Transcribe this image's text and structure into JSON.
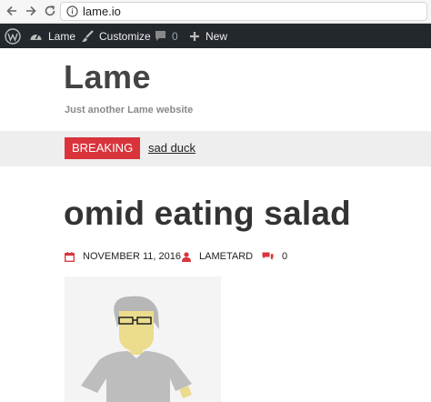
{
  "browser": {
    "url": "lame.io"
  },
  "admin_bar": {
    "site_name": "Lame",
    "customize_label": "Customize",
    "comments_count": "0",
    "new_label": "New"
  },
  "site": {
    "title": "Lame",
    "tagline": "Just another Lame website"
  },
  "breaking": {
    "badge": "BREAKING",
    "headline": "sad duck"
  },
  "post": {
    "title": "omid eating salad",
    "date": "NOVEMBER 11, 2016",
    "author": "LAMETARD",
    "comments": "0"
  },
  "colors": {
    "admin_bg": "#23282d",
    "accent_red": "#d9343c",
    "breaking_bg": "#eeeeee"
  }
}
